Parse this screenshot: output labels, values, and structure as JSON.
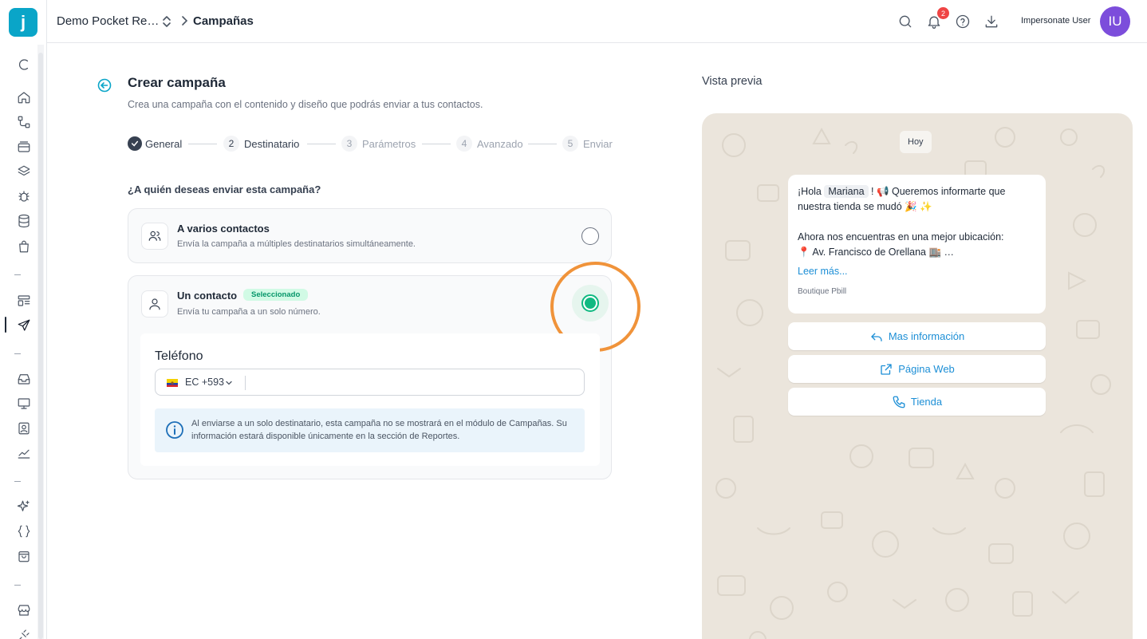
{
  "header": {
    "workspace_name": "Demo Pocket Re…",
    "breadcrumb_current": "Campañas",
    "notification_count": "2",
    "user_name": "Impersonate User",
    "user_initials": "IU"
  },
  "form": {
    "title": "Crear campaña",
    "subtitle": "Crea una campaña con el contenido y diseño que podrás enviar a tus contactos.",
    "steps": [
      {
        "num": "",
        "label": "General",
        "state": "done"
      },
      {
        "num": "2",
        "label": "Destinatario",
        "state": "current"
      },
      {
        "num": "3",
        "label": "Parámetros",
        "state": "pending"
      },
      {
        "num": "4",
        "label": "Avanzado",
        "state": "pending"
      },
      {
        "num": "5",
        "label": "Enviar",
        "state": "pending"
      }
    ],
    "question": "¿A quién deseas enviar esta campaña?",
    "options": [
      {
        "title": "A varios contactos",
        "description": "Envía la campaña a múltiples destinatarios simultáneamente.",
        "selected": false
      },
      {
        "title": "Un contacto",
        "description": "Envía tu campaña a un solo número.",
        "selected": true,
        "badge": "Seleccionado"
      }
    ],
    "phone": {
      "label": "Teléfono",
      "country_code": "EC +593",
      "value": ""
    },
    "info": "Al enviarse a un solo destinatario, esta campaña no se mostrará en el módulo de Campañas. Su información estará disponible únicamente en la sección de Reportes."
  },
  "preview": {
    "title": "Vista previa",
    "date_chip": "Hoy",
    "message": {
      "line1_pre": "¡Hola",
      "variable": "Mariana",
      "line1_post": "! 📢 Queremos informarte que",
      "line2": "nuestra tienda se mudó 🎉 ✨",
      "line3": "Ahora nos encuentras en una mejor ubicación:",
      "line4": "📍 Av. Francisco de Orellana 🏬 …",
      "read_more": "Leer más...",
      "footer": "Boutique Pbill"
    },
    "buttons": [
      "Mas información",
      "Página Web",
      "Tienda"
    ]
  },
  "colors": {
    "brand": "#0aa5c8",
    "accent_green": "#10b981",
    "avatar": "#7c4ddb",
    "link_blue": "#1d8fd6",
    "highlight": "#f0933a"
  }
}
